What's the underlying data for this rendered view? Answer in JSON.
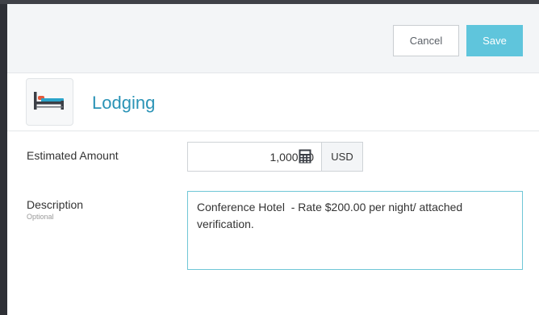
{
  "toolbar": {
    "cancel_label": "Cancel",
    "save_label": "Save",
    "accent_color": "#5fc5dc"
  },
  "header": {
    "icon": "bed-icon",
    "title": "Lodging",
    "title_color": "#2a93b6"
  },
  "form": {
    "amount": {
      "label": "Estimated Amount",
      "value": "1,000.00",
      "calculator_icon": "calculator-icon",
      "currency": "USD"
    },
    "description": {
      "label": "Description",
      "sublabel": "Optional",
      "value": "Conference Hotel  - Rate $200.00 per night/ attached verification."
    }
  }
}
